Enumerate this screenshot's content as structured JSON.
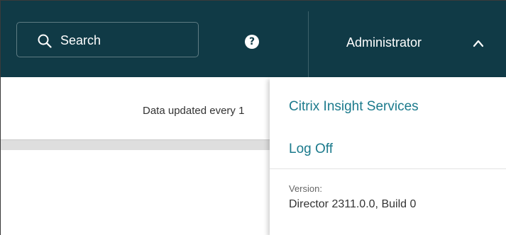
{
  "header": {
    "search_label": "Search",
    "help_icon": "question-circle",
    "user_name": "Administrator",
    "chevron_icon": "chevron-up"
  },
  "content": {
    "updated_text": "Data updated every 1"
  },
  "user_menu": {
    "items": [
      {
        "label": "Citrix Insight Services"
      },
      {
        "label": "Log Off"
      }
    ],
    "version_label": "Version:",
    "version_value": "Director 2311.0.0, Build 0"
  },
  "colors": {
    "header_bg": "#103a46",
    "link": "#1b7a8c",
    "text_dark": "#333333"
  }
}
